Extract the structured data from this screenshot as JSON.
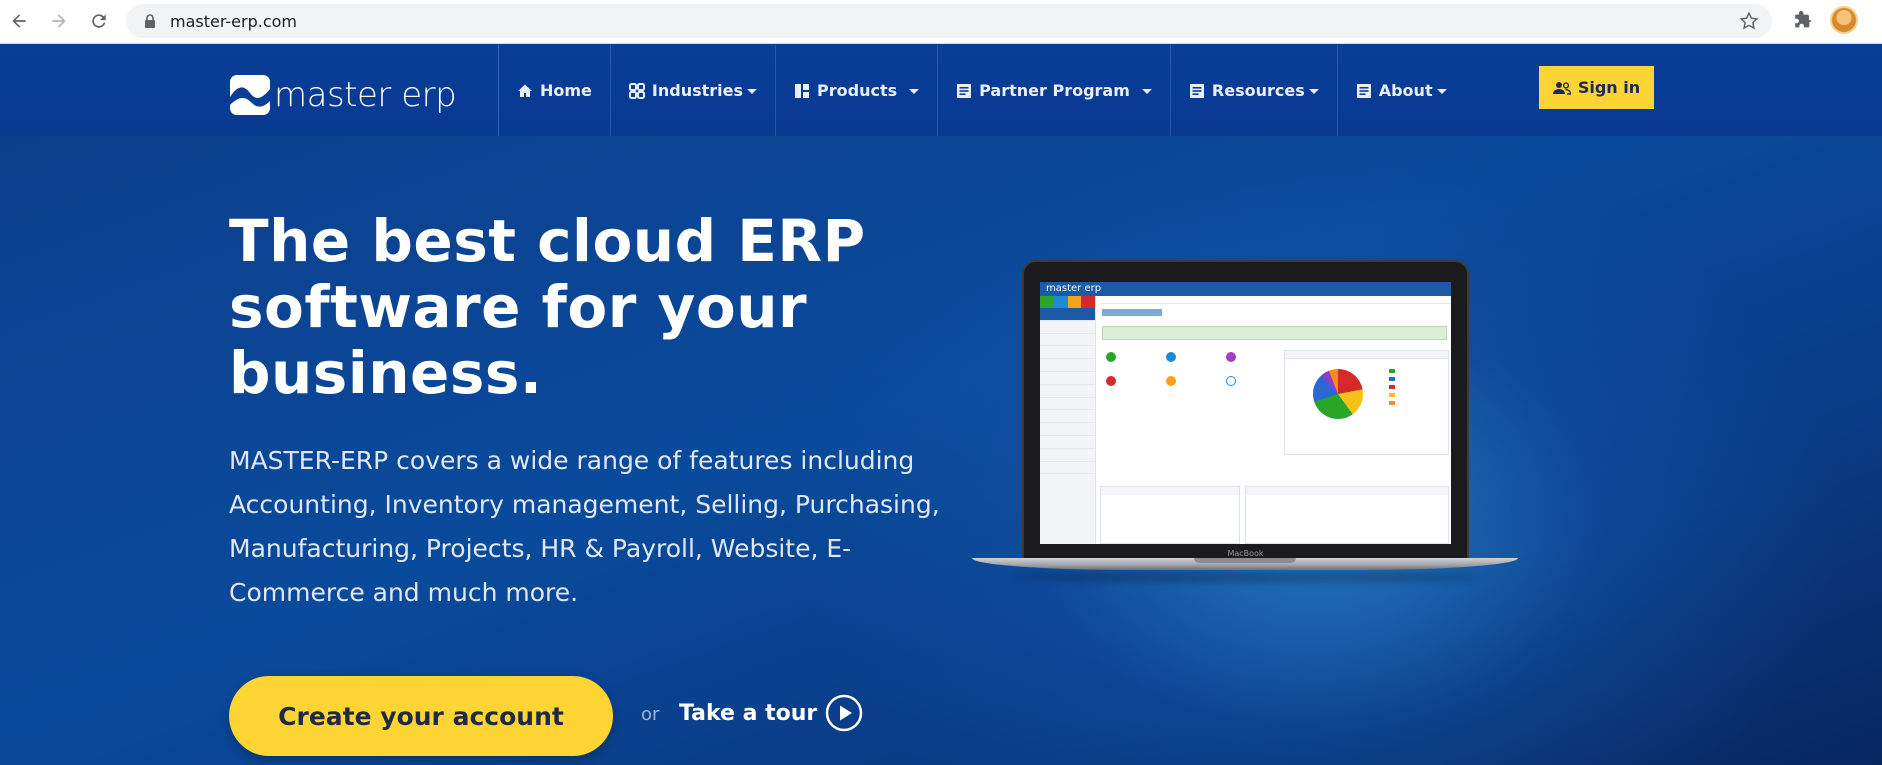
{
  "browser": {
    "url": "master-erp.com"
  },
  "header": {
    "logo_text": "master erp",
    "menu": [
      {
        "label": "Home",
        "icon": "home-icon",
        "has_caret": false
      },
      {
        "label": "Industries",
        "icon": "industries-icon",
        "has_caret": true
      },
      {
        "label": "Products",
        "icon": "grid-icon",
        "has_caret": true
      },
      {
        "label": "Partner Program",
        "icon": "document-icon",
        "has_caret": true
      },
      {
        "label": "Resources",
        "icon": "document-icon",
        "has_caret": true
      },
      {
        "label": "About",
        "icon": "document-icon",
        "has_caret": true
      }
    ],
    "signin_label": "Sign in"
  },
  "hero": {
    "title": "The best cloud ERP software for your business.",
    "description": "MASTER-ERP covers a wide range of features including Accounting, Inventory management, Selling, Purchasing, Manufacturing, Projects, HR & Payroll, Website, E-Commerce and much more.",
    "cta_label": "Create your account",
    "or_text": "or",
    "tour_label": "Take a tour"
  },
  "mockup": {
    "screen_brand": "master erp",
    "laptop_label": "MacBook"
  },
  "colors": {
    "header_bg": "#0a3d97",
    "accent_yellow": "#fcd535",
    "hero_bg": "#0a4a9c"
  }
}
